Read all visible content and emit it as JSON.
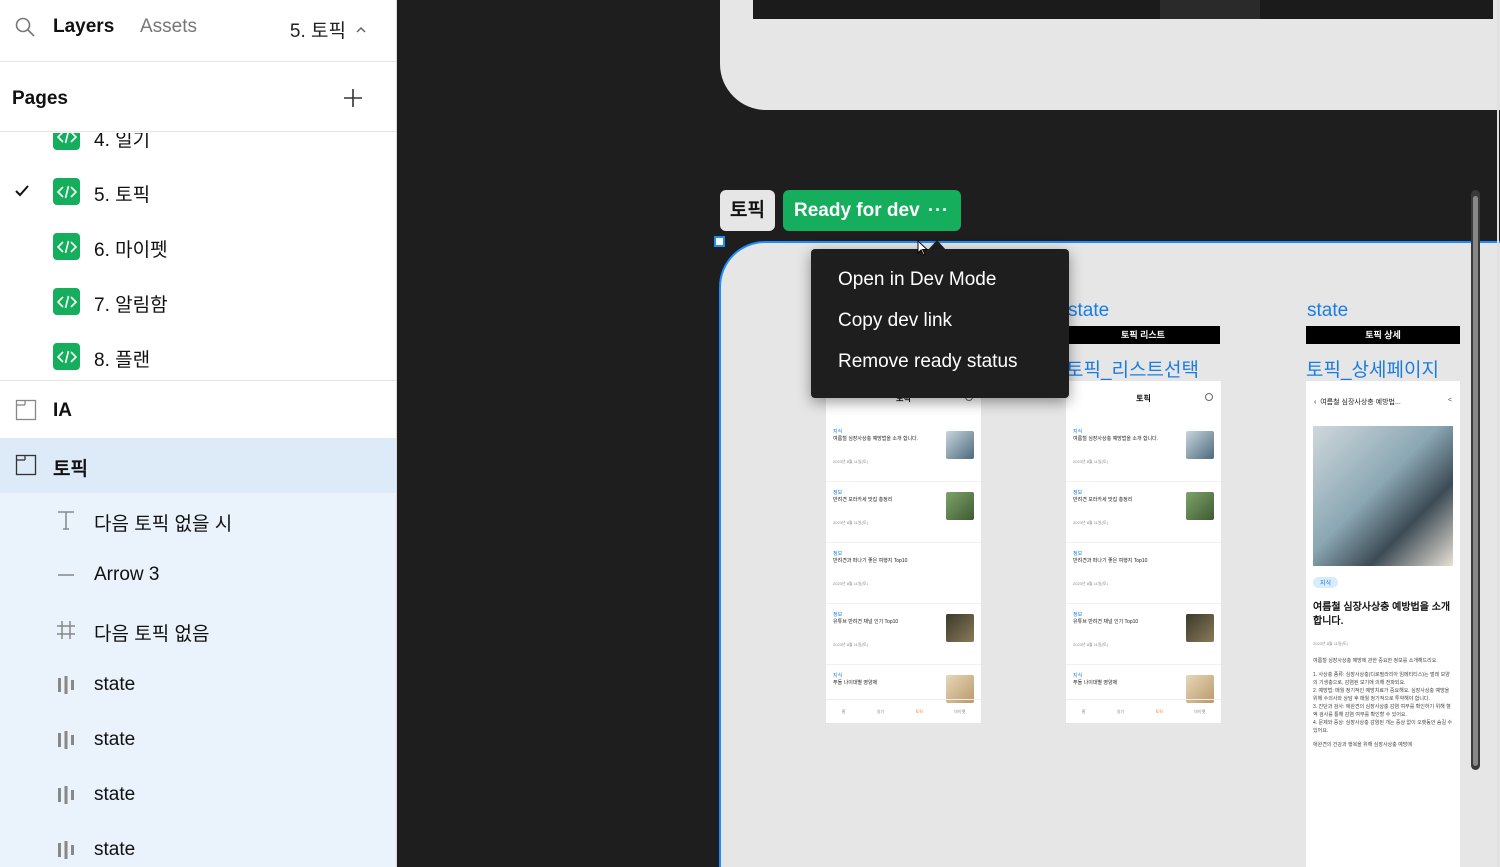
{
  "topbar": {
    "tab_layers": "Layers",
    "tab_assets": "Assets",
    "current_page": "5. 토픽"
  },
  "pages": {
    "label": "Pages",
    "items": [
      {
        "label": "4. 일기",
        "current": false
      },
      {
        "label": "5. 토픽",
        "current": true
      },
      {
        "label": "6. 마이펫",
        "current": false
      },
      {
        "label": "7. 알림함",
        "current": false
      },
      {
        "label": "8. 플랜",
        "current": false
      }
    ]
  },
  "layers": [
    {
      "label": "IA",
      "type": "section-icon",
      "bold": true
    },
    {
      "label": "토픽",
      "type": "section-icon",
      "bold": true,
      "selected": true
    },
    {
      "label": "다음 토픽 없을 시",
      "type": "text-icon"
    },
    {
      "label": "Arrow 3",
      "type": "line-icon"
    },
    {
      "label": "다음 토픽 없음",
      "type": "frame-icon"
    },
    {
      "label": "state",
      "type": "component-set-icon"
    },
    {
      "label": "state",
      "type": "component-set-icon"
    },
    {
      "label": "state",
      "type": "component-set-icon"
    },
    {
      "label": "state",
      "type": "component-set-icon"
    }
  ],
  "canvas": {
    "section_name": "토픽",
    "ready_label": "Ready for dev",
    "ready_dots": "···",
    "frames": [
      {
        "state_label": "state",
        "title_bar": "토픽 리스트",
        "frame_name": "토픽_리스트선택"
      },
      {
        "state_label": "state",
        "title_bar": "토픽 상세",
        "frame_name": "토픽_상세페이지"
      }
    ],
    "list_phone": {
      "header": "토픽",
      "cards": [
        {
          "category": "지식",
          "title": "여름철 심장사상충 예방법을 소개 합니다.",
          "date": "2023년 8월 11일(토)"
        },
        {
          "category": "정보",
          "title": "반려견 모라카세 맛집 총정리",
          "date": "2023년 8월 11일(토)"
        },
        {
          "category": "정보",
          "title": "반려견과 떠나기 좋은 여행지 Top10",
          "date": "2023년 8월 11일(토)"
        },
        {
          "category": "정보",
          "title": "유튜브 반려견 채널 인기 Top10",
          "date": "2023년 8월 11일(토)"
        },
        {
          "category": "지식",
          "title": "푸들 나이대별 영양제",
          "date": ""
        }
      ],
      "tabs": [
        {
          "label": "홈",
          "active": false
        },
        {
          "label": "일기",
          "active": false
        },
        {
          "label": "토픽",
          "active": true
        },
        {
          "label": "마이펫",
          "active": false
        }
      ]
    },
    "detail_phone": {
      "top_title": "여름철 심장사상충 예방법...",
      "chip": "지식",
      "headline": "여름철 심장사상충 예방법을 소개합니다.",
      "date": "2023년 8월 11일(토)",
      "intro": "여름철 심장사상충 예방에 관한 중요한 정보를 소개해드리요.",
      "points": [
        "1. 사상충 종류: 심장사상충(디로필라리아 임메티티스)는 벌레 모양의 기생충으로, 감염된 모기에 의해 전파되요.",
        "2. 예방법: 매월 정기적인 예방치료가 중요해요. 심장사상충 예방을 위해 수의사와 상담 후 매월 정기적으로 투약해야 합니다.",
        "3. 진단과 검사: 애완견의 심장사상충 감염 여부를 확인하기 위해 혈액 검사를 통해 감염 여부를 확인할 수 있어요.",
        "4. 문제와 증상: 심장사상충 감염된 개는 증상 없이 오랫동안 숨길 수 있어요."
      ],
      "outro": "애완견의 건강과 행복을 위해 심장사상충 예방에"
    }
  },
  "context_menu": {
    "items": [
      "Open in Dev Mode",
      "Copy dev link",
      "Remove ready status"
    ]
  },
  "colors": {
    "accent": "#1a8cff",
    "dev_green": "#14ae5c",
    "selected_row": "#ddeaf8",
    "canvas_bg": "#1e1e1e",
    "link_blue": "#1a7de0",
    "active_tab": "#f07c2b"
  }
}
